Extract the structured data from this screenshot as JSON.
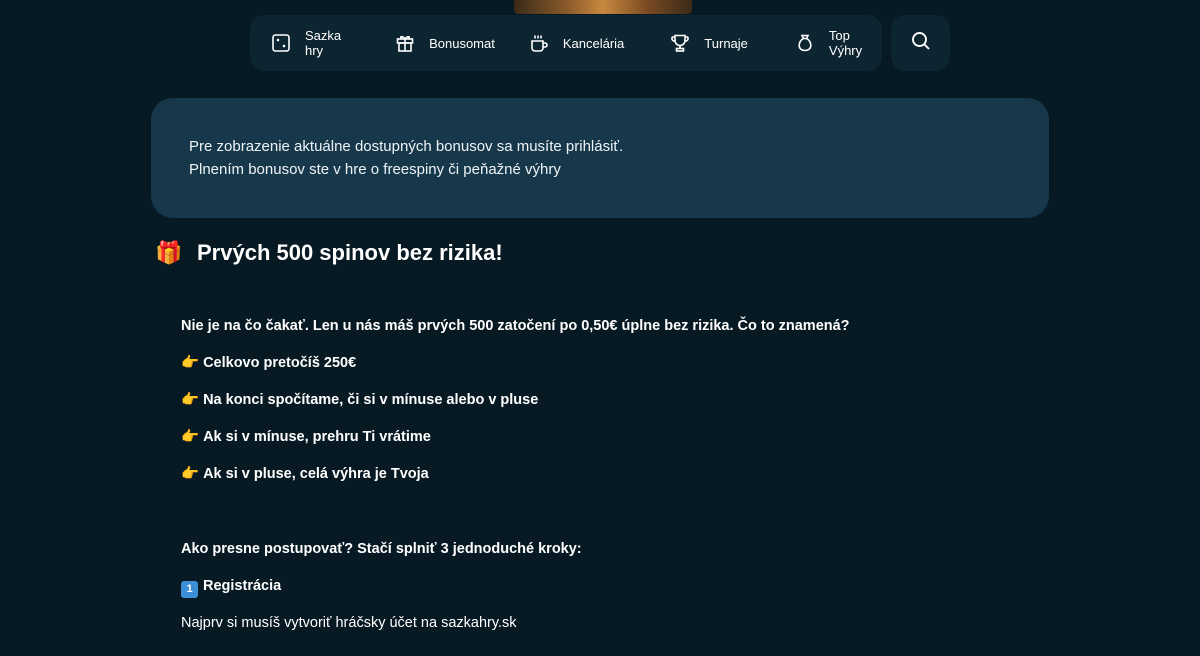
{
  "nav": {
    "items": [
      {
        "label": "Sazka hry",
        "icon": "dice-icon"
      },
      {
        "label": "Bonusomat",
        "icon": "gift-icon"
      },
      {
        "label": "Kancelária",
        "icon": "coffee-mug-icon"
      },
      {
        "label": "Turnaje",
        "icon": "trophy-icon"
      },
      {
        "label": "Top Výhry",
        "icon": "money-bag-icon"
      }
    ],
    "search_icon": "search-icon"
  },
  "info": {
    "line1": "Pre zobrazenie aktuálne dostupných bonusov sa musíte prihlásiť.",
    "line2": "Plnením bonusov ste v hre o freespiny či peňažné výhry"
  },
  "promo": {
    "emoji": "🎁",
    "title": "Prvých 500 spinov bez rizika!",
    "intro": "Nie je na čo čakať. Len u nás máš prvých 500 zatočení po 0,50€ úplne bez rizika. Čo to znamená?",
    "point_emoji": "👉",
    "points": [
      "Celkovo pretočíš 250€",
      "Na konci spočítame, či si v mínuse alebo v pluse",
      "Ak si v mínuse, prehru Ti vrátime",
      "Ak si v pluse, celá výhra je Tvoja"
    ],
    "steps_intro": "Ako presne postupovať? Stačí splniť 3 jednoduché kroky:",
    "step1_number": "1",
    "step1_title": "Registrácia",
    "step1_text": "Najprv si musíš vytvoriť hráčsky účet na sazkahry.sk"
  },
  "colors": {
    "background": "#071923",
    "nav_bg": "#0d2431",
    "info_bg": "#17384b"
  }
}
